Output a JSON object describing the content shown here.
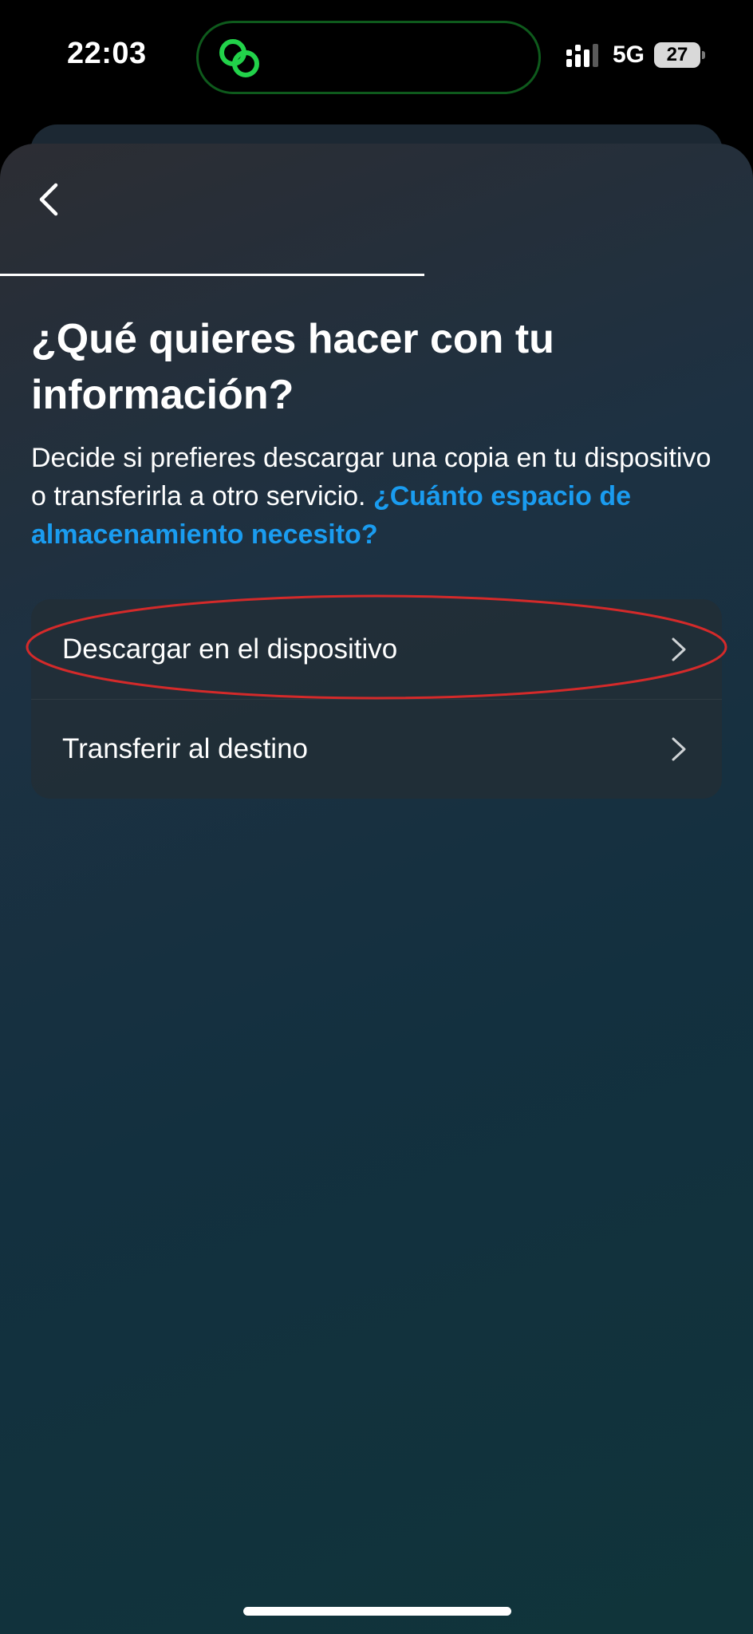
{
  "status_bar": {
    "time": "22:03",
    "network": "5G",
    "battery_level": "27",
    "island_icon": "link-rings-icon",
    "signal_icon": "signal-bars-icon"
  },
  "header": {
    "back_icon": "chevron-left-icon",
    "progress_fraction": 0.6
  },
  "main": {
    "title": "¿Qué quieres hacer con tu información?",
    "description": "Decide si prefieres descargar una copia en tu dispositivo o transferirla a otro servicio.",
    "storage_link": "¿Cuánto espacio de almacenamiento necesito?"
  },
  "options": [
    {
      "label": "Descargar en el dispositivo",
      "icon": "chevron-right-icon",
      "highlighted": true
    },
    {
      "label": "Transferir al destino",
      "icon": "chevron-right-icon",
      "highlighted": false
    }
  ],
  "colors": {
    "accent_link": "#1a9cf0",
    "annotation_ellipse": "#d42a2a",
    "island_icon": "#22d24a"
  }
}
